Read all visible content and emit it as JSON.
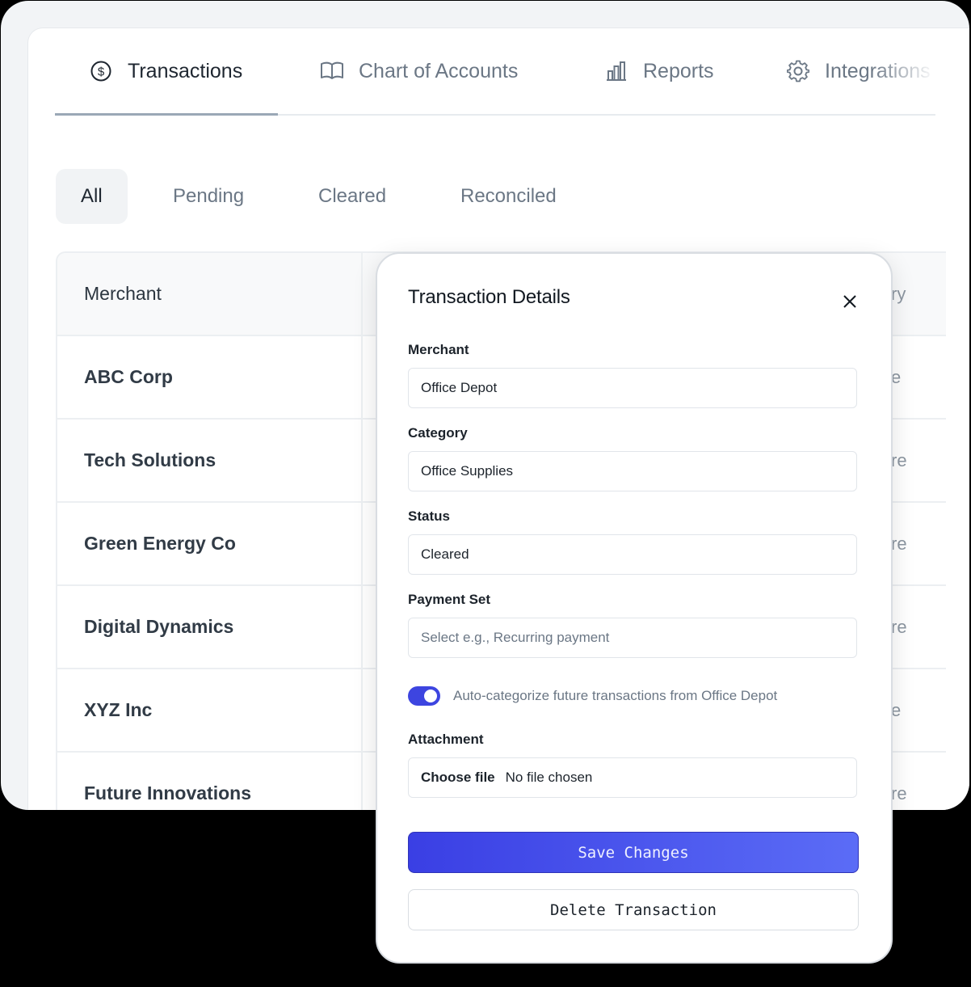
{
  "nav": {
    "tabs": [
      {
        "label": "Transactions",
        "icon": "dollar-circle-icon"
      },
      {
        "label": "Chart of Accounts",
        "icon": "book-open-icon"
      },
      {
        "label": "Reports",
        "icon": "bar-chart-icon"
      },
      {
        "label": "Integrations",
        "icon": "gear-icon"
      }
    ],
    "active": "Transactions"
  },
  "filters": {
    "tabs": [
      "All",
      "Pending",
      "Cleared",
      "Reconciled"
    ],
    "active": "All"
  },
  "table": {
    "header_merchant": "Merchant",
    "header_partial": "ry",
    "rows": [
      {
        "merchant": "ABC Corp",
        "partial": "e"
      },
      {
        "merchant": "Tech Solutions",
        "partial": "re"
      },
      {
        "merchant": "Green Energy Co",
        "partial": "re"
      },
      {
        "merchant": "Digital Dynamics",
        "partial": "re"
      },
      {
        "merchant": "XYZ Inc",
        "partial": "e"
      },
      {
        "merchant": "Future Innovations",
        "partial": "re"
      }
    ]
  },
  "modal": {
    "title": "Transaction Details",
    "merchant_label": "Merchant",
    "merchant_value": "Office Depot",
    "category_label": "Category",
    "category_value": "Office Supplies",
    "status_label": "Status",
    "status_value": "Cleared",
    "payment_set_label": "Payment Set",
    "payment_set_placeholder": "Select e.g., Recurring payment",
    "auto_categorize_label": "Auto-categorize future transactions from Office Depot",
    "auto_categorize_on": true,
    "attachment_label": "Attachment",
    "choose_file_label": "Choose file",
    "no_file_label": "No file chosen",
    "save_label": "Save Changes",
    "delete_label": "Delete Transaction"
  },
  "colors": {
    "accent": "#3d45e0",
    "background": "#000000",
    "text": "#1e2630",
    "muted": "#6b7785"
  }
}
